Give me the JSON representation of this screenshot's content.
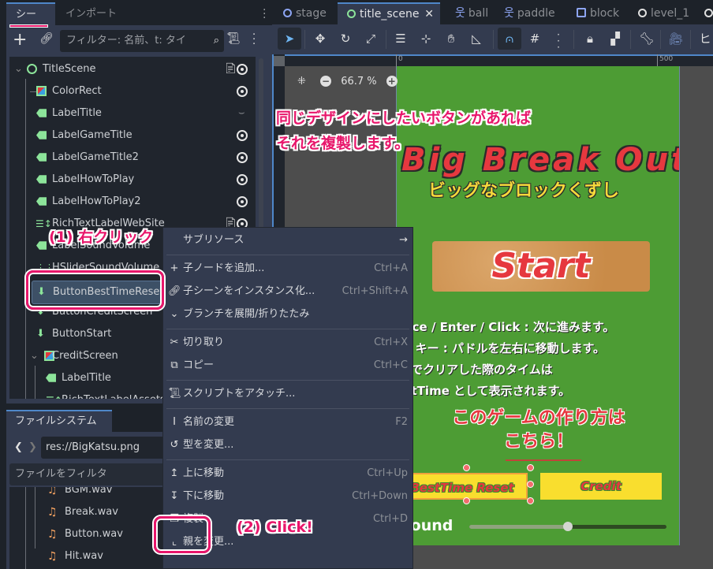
{
  "left_dock": {
    "tabs": [
      {
        "label": "シーン",
        "active": true
      },
      {
        "label": "インポート",
        "active": false
      }
    ],
    "toolbar": {
      "add_icon": "plus-icon",
      "link_icon": "link-icon",
      "filter_placeholder": "フィルター: 名前、t: タイ",
      "search_icon": "search-icon",
      "attach_script_icon": "script-add-icon",
      "more_icon": "kebab-menu-icon"
    },
    "tree": [
      {
        "label": "TitleScene",
        "icon": "node2d-ring-icon",
        "depth": 0,
        "expanded": true,
        "script": true,
        "visibility": "eye"
      },
      {
        "label": "ColorRect",
        "icon": "colorrect-icon",
        "depth": 1,
        "visibility": "eye"
      },
      {
        "label": "LabelTitle",
        "icon": "label-icon",
        "depth": 1,
        "visibility": "hidden"
      },
      {
        "label": "LabelGameTitle",
        "icon": "label-icon",
        "depth": 1,
        "visibility": "eye"
      },
      {
        "label": "LabelGameTitle2",
        "icon": "label-icon",
        "depth": 1,
        "visibility": "eye"
      },
      {
        "label": "LabelHowToPlay",
        "icon": "label-icon",
        "depth": 1,
        "visibility": "eye"
      },
      {
        "label": "LabelHowToPlay2",
        "icon": "label-icon",
        "depth": 1,
        "visibility": "eye"
      },
      {
        "label": "RichTextLabelWebSite",
        "icon": "richtext-icon",
        "depth": 1,
        "script": true,
        "visibility": "eye"
      },
      {
        "label": "LabelSoundVolume",
        "icon": "label-icon",
        "depth": 1
      },
      {
        "label": "HSliderSoundVolume",
        "icon": "hslider-icon",
        "depth": 1
      },
      {
        "label": "ButtonBestTimeReset",
        "icon": "button-icon",
        "depth": 1,
        "selected": true
      },
      {
        "label": "ButtonCreditScreen",
        "icon": "button-icon",
        "depth": 1
      },
      {
        "label": "ButtonStart",
        "icon": "button-icon",
        "depth": 1
      },
      {
        "label": "CreditScreen",
        "icon": "colorrect-icon",
        "depth": 1,
        "expanded": true
      },
      {
        "label": "LabelTitle",
        "icon": "label-icon",
        "depth": 2
      },
      {
        "label": "RichTextLabelAssets",
        "icon": "richtext-icon",
        "depth": 2
      }
    ]
  },
  "filesystem": {
    "tab_label": "ファイルシステム",
    "path": "res://BigKatsu.png",
    "filter_placeholder": "ファイルをフィルタ",
    "files": [
      "BGM.wav",
      "Break.wav",
      "Button.wav",
      "Hit.wav"
    ]
  },
  "editor": {
    "scene_tabs": [
      {
        "label": "stage",
        "icon": "ring-icon",
        "color": "#8da5f3"
      },
      {
        "label": "title_scene",
        "icon": "ring-icon",
        "color": "#8ce49a",
        "active": true,
        "closable": true
      },
      {
        "label": "ball",
        "icon": "character-icon",
        "color": "#8da5f3"
      },
      {
        "label": "paddle",
        "icon": "character-icon",
        "color": "#8da5f3"
      },
      {
        "label": "block",
        "icon": "static-body-icon",
        "color": "#8da5f3"
      },
      {
        "label": "level_1",
        "icon": "ring-icon",
        "color": "#e0e0e0"
      }
    ],
    "toolbar_tools": [
      "select-icon",
      "move-icon",
      "rotate-icon",
      "scale-icon",
      "list-select-icon",
      "pivot-icon",
      "pan-icon",
      "ruler-icon",
      "snap-icon",
      "grid-snap-icon",
      "more-icon",
      "lock-icon",
      "group-icon",
      "bone-icon",
      "camera-icon",
      "view-icon"
    ],
    "ruler_labels": [
      "0",
      "500"
    ],
    "zoom_level": "66.7 %"
  },
  "game_preview": {
    "title": "Big Break Out",
    "subtitle": "ビッグなブロックくずし",
    "start_label": "Start",
    "howto_lines": [
      "Space / Enter / Click : 次に進みます。",
      "← → キー : パドルを左右に移動します。",
      "最速でクリアした際のタイムは",
      "BestTime として表示されます。"
    ],
    "link_line1": "このゲームの作り方は",
    "link_line2": "こちら！",
    "best_time_button": "BestTime Reset",
    "credit_button": "Credit",
    "sound_label": "Sound",
    "sound_volume": 0.5
  },
  "context_menu": {
    "items": [
      {
        "icon": "",
        "label": "サブリソース",
        "shortcut": "",
        "submenu": true
      },
      {
        "separator": true
      },
      {
        "icon": "plus-icon",
        "label": "子ノードを追加...",
        "shortcut": "Ctrl+A"
      },
      {
        "icon": "link-icon",
        "label": "子シーンをインスタンス化...",
        "shortcut": "Ctrl+Shift+A"
      },
      {
        "icon": "chevron-down-icon",
        "label": "ブランチを展開/折りたたみ",
        "shortcut": ""
      },
      {
        "separator": true
      },
      {
        "icon": "scissors-icon",
        "label": "切り取り",
        "shortcut": "Ctrl+X"
      },
      {
        "icon": "copy-icon",
        "label": "コピー",
        "shortcut": "Ctrl+C"
      },
      {
        "separator": true
      },
      {
        "icon": "script-add-icon",
        "label": "スクリプトをアタッチ...",
        "shortcut": ""
      },
      {
        "separator": true
      },
      {
        "icon": "rename-icon",
        "label": "名前の変更",
        "shortcut": "F2"
      },
      {
        "icon": "change-type-icon",
        "label": "型を変更...",
        "shortcut": ""
      },
      {
        "separator": true
      },
      {
        "icon": "move-up-icon",
        "label": "上に移動",
        "shortcut": "Ctrl+Up"
      },
      {
        "icon": "move-down-icon",
        "label": "下に移動",
        "shortcut": "Ctrl+Down"
      },
      {
        "icon": "duplicate-icon",
        "label": "複製",
        "shortcut": "Ctrl+D"
      },
      {
        "icon": "reparent-icon",
        "label": "親を変更...",
        "shortcut": ""
      }
    ],
    "submenu_arrow": "→"
  },
  "annotations": {
    "step1": "(1) 右クリック",
    "step2": "(2) Click!",
    "note_line1": "同じデザインにしたいボタンがあれば",
    "note_line2": "それを複製します。",
    "highlight_color": "#e8166b"
  }
}
